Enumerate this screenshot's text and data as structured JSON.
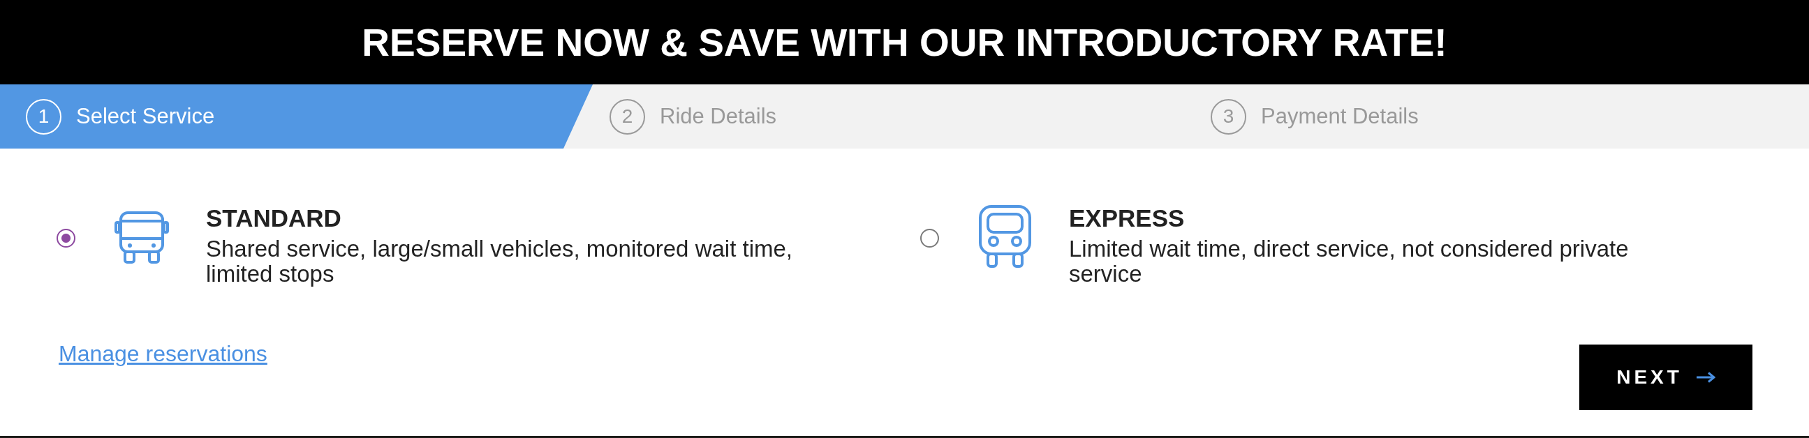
{
  "banner": {
    "title": "RESERVE NOW & SAVE WITH OUR INTRODUCTORY RATE!"
  },
  "steps": [
    {
      "number": "1",
      "label": "Select Service",
      "selected": true
    },
    {
      "number": "2",
      "label": "Ride Details",
      "selected": false
    },
    {
      "number": "3",
      "label": "Payment Details",
      "selected": false
    }
  ],
  "services": [
    {
      "title": "STANDARD",
      "description": "Shared service, large/small vehicles, monitored wait time, limited stops",
      "selected": true
    },
    {
      "title": "EXPRESS",
      "description": "Limited wait time, direct service, not considered private service",
      "selected": false
    }
  ],
  "manage_link": "Manage reservations",
  "next_button": {
    "label": "NEXT"
  }
}
